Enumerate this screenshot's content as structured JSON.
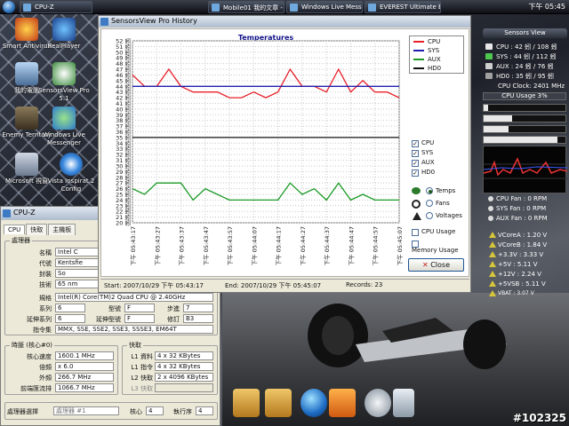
{
  "taskbar": {
    "buttons": [
      "CPU-Z",
      "Mobile01 我的文章 - ...",
      "Windows Live Messen...",
      "EVEREST Ultimate Edit..."
    ],
    "clock": "下午 05:45"
  },
  "desktop_icons": [
    {
      "label": "Smart Antivirus"
    },
    {
      "label": "RealPlayer"
    },
    {
      "label": "我的電腦"
    },
    {
      "label": "SensorsView Pro 5.1"
    },
    {
      "label": "Enemy Territory"
    },
    {
      "label": "Windows Live Messenger"
    },
    {
      "label": "Microsoft 視窗"
    },
    {
      "label": "Vista Inspirat 2 Config"
    }
  ],
  "cpuz": {
    "title": "CPU-Z",
    "tabs": [
      "CPU",
      "快取",
      "主機板"
    ],
    "processor_group": "處理器",
    "labels": {
      "name": "名稱",
      "codename": "代號",
      "package": "封裝",
      "tech": "技術",
      "spec": "規格",
      "family": "系列",
      "ext_family": "延伸系列",
      "instr": "指令集",
      "model": "型號",
      "ext_model": "延伸型號",
      "stepping": "步進",
      "revision": "修訂"
    },
    "values": {
      "name": "Intel C",
      "codename": "Kentsfie",
      "package": "So",
      "tech": "65 nm",
      "spec": "Intel(R) Core(TM)2 Quad CPU    @ 2.40GHz",
      "family": "6",
      "ext_family": "6",
      "model": "F",
      "ext_model": "F",
      "stepping": "7",
      "revision": "B3",
      "instr": "MMX, SSE, SSE2, SSE3, SSSE3, EM64T"
    },
    "clocks_group": "時脈 (核心#0)",
    "clock_labels": {
      "core_speed": "核心速度",
      "multiplier": "倍頻",
      "bus": "外頻",
      "fsb": "前端匯流排"
    },
    "clock_values": {
      "core_speed": "1600.1 MHz",
      "multiplier": "x 6.0",
      "bus": "266.7 MHz",
      "fsb": "1066.7 MHz"
    },
    "cache_group": "快取",
    "cache_labels": {
      "l1d": "L1 資料",
      "l1i": "L1 指令",
      "l2": "L2 快取",
      "l3": "L3 快取"
    },
    "cache_values": {
      "l1d": "4 x 32 KBytes",
      "l1i": "4 x 32 KBytes",
      "l2": "2 x 4096 KBytes",
      "l3": ""
    },
    "selection_label": "處理器選擇",
    "selection_value": "處理器 #1",
    "cores_label": "核心",
    "cores_value": "4",
    "threads_label": "執行序",
    "threads_value": "4"
  },
  "history": {
    "title": "SensorsView Pro History",
    "legend": [
      "CPU",
      "SYS",
      "AUX",
      "HD0"
    ],
    "checkboxes": [
      {
        "label": "CPU",
        "checked": true
      },
      {
        "label": "SYS",
        "checked": true
      },
      {
        "label": "AUX",
        "checked": true
      },
      {
        "label": "HD0",
        "checked": true
      }
    ],
    "radios": [
      {
        "label": "Temps",
        "selected": true
      },
      {
        "label": "Fans",
        "selected": false
      },
      {
        "label": "Voltages",
        "selected": false
      }
    ],
    "cpu_usage_label": "CPU Usage",
    "memory_usage_label": "Memory Usage",
    "close_label": "Close",
    "status": {
      "start": "Start: 2007/10/29 下午 05:43:17",
      "end": "End: 2007/10/29 下午 05:45:07",
      "records": "Records: 23"
    }
  },
  "sensorsview": {
    "title": "Sensors View",
    "rows": [
      "CPU : 42 蚓 / 108 蚓",
      "SYS : 44 蚓 / 112 蚓",
      "AUX : 24 蚓 / 76 蚓",
      "HD0 : 35 蚓 / 95 蚓"
    ],
    "cpu_clock": "CPU Clock: 2401 MHz",
    "cpu_usage": "CPU Usage 3%",
    "cpu_usage_pct": 3,
    "mem_bars": [
      0.05,
      0.35,
      0.3,
      0.9
    ],
    "mem_labels": [
      "",
      "M",
      "",
      ""
    ],
    "fans": [
      "CPU Fan : 0 RPM",
      "SYS Fan : 0 RPM",
      "AUX Fan : 0 RPM"
    ],
    "voltages": [
      "VCoreA : 1.20 V",
      "VCoreB : 1.84 V",
      "+3.3V : 3.33 V",
      "+5V : 5.11 V",
      "+12V : 2.24 V",
      "+5VSB : 5.11 V",
      "VBAT : 3.07 V"
    ]
  },
  "watermark": "#102325",
  "chart_data": {
    "type": "line",
    "title": "Temperatures",
    "xlabel": "",
    "ylabel": "",
    "ylim": [
      20,
      52
    ],
    "grid": true,
    "legend_position": "right",
    "yticks": [
      "20 蚓",
      "21 蚓",
      "22 蚓",
      "23 蚓",
      "24 蚓",
      "25 蚓",
      "26 蚓",
      "27 蚓",
      "28 蚓",
      "29 蚓",
      "30 蚓",
      "31 蚓",
      "32 蚓",
      "33 蚓",
      "34 蚓",
      "35 蚓",
      "36 蚓",
      "37 蚓",
      "38 蚓",
      "39 蚓",
      "40 蚓",
      "41 蚓",
      "42 蚓",
      "43 蚓",
      "44 蚓",
      "45 蚓",
      "46 蚓",
      "47 蚓",
      "48 蚓",
      "49 蚓",
      "50 蚓",
      "51 蚓",
      "52 蚓"
    ],
    "x": [
      "下午 05:43:17",
      "下午 05:43:22",
      "下午 05:43:27",
      "下午 05:43:32",
      "下午 05:43:37",
      "下午 05:43:42",
      "下午 05:43:47",
      "下午 05:43:52",
      "下午 05:43:57",
      "下午 05:44:02",
      "下午 05:44:07",
      "下午 05:44:12",
      "下午 05:44:17",
      "下午 05:44:22",
      "下午 05:44:27",
      "下午 05:44:32",
      "下午 05:44:37",
      "下午 05:44:42",
      "下午 05:44:47",
      "下午 05:44:52",
      "下午 05:44:57",
      "下午 05:45:02",
      "下午 05:45:07"
    ],
    "xtick_labels": [
      "下午 05:43:17",
      "下午 05:43:27",
      "下午 05:43:37",
      "下午 05:43:47",
      "下午 05:43:57",
      "下午 05:44:07",
      "下午 05:44:17",
      "下午 05:44:27",
      "下午 05:44:37",
      "下午 05:44:47",
      "下午 05:44:57",
      "下午 05:45:07"
    ],
    "series": [
      {
        "name": "CPU",
        "color": "#e8202a",
        "values": [
          46,
          44,
          44,
          47,
          44,
          43,
          43,
          43,
          42,
          42,
          43,
          42,
          43,
          47,
          44,
          44,
          43,
          47,
          43,
          45,
          43,
          43,
          42
        ]
      },
      {
        "name": "SYS",
        "color": "#1f1fb0",
        "values": [
          44,
          44,
          44,
          44,
          44,
          44,
          44,
          44,
          44,
          44,
          44,
          44,
          44,
          44,
          44,
          44,
          44,
          44,
          44,
          44,
          44,
          44,
          44
        ]
      },
      {
        "name": "AUX",
        "color": "#1c9a26",
        "values": [
          26,
          25,
          27,
          27,
          27,
          24,
          26,
          25,
          24,
          24,
          24,
          24,
          24,
          27,
          25,
          26,
          24,
          27,
          24,
          25,
          24,
          24,
          24
        ]
      },
      {
        "name": "HD0",
        "color": "#111111",
        "values": [
          35,
          35,
          35,
          35,
          35,
          35,
          35,
          35,
          35,
          35,
          35,
          35,
          35,
          35,
          35,
          35,
          35,
          35,
          35,
          35,
          35,
          35,
          35
        ]
      }
    ]
  }
}
